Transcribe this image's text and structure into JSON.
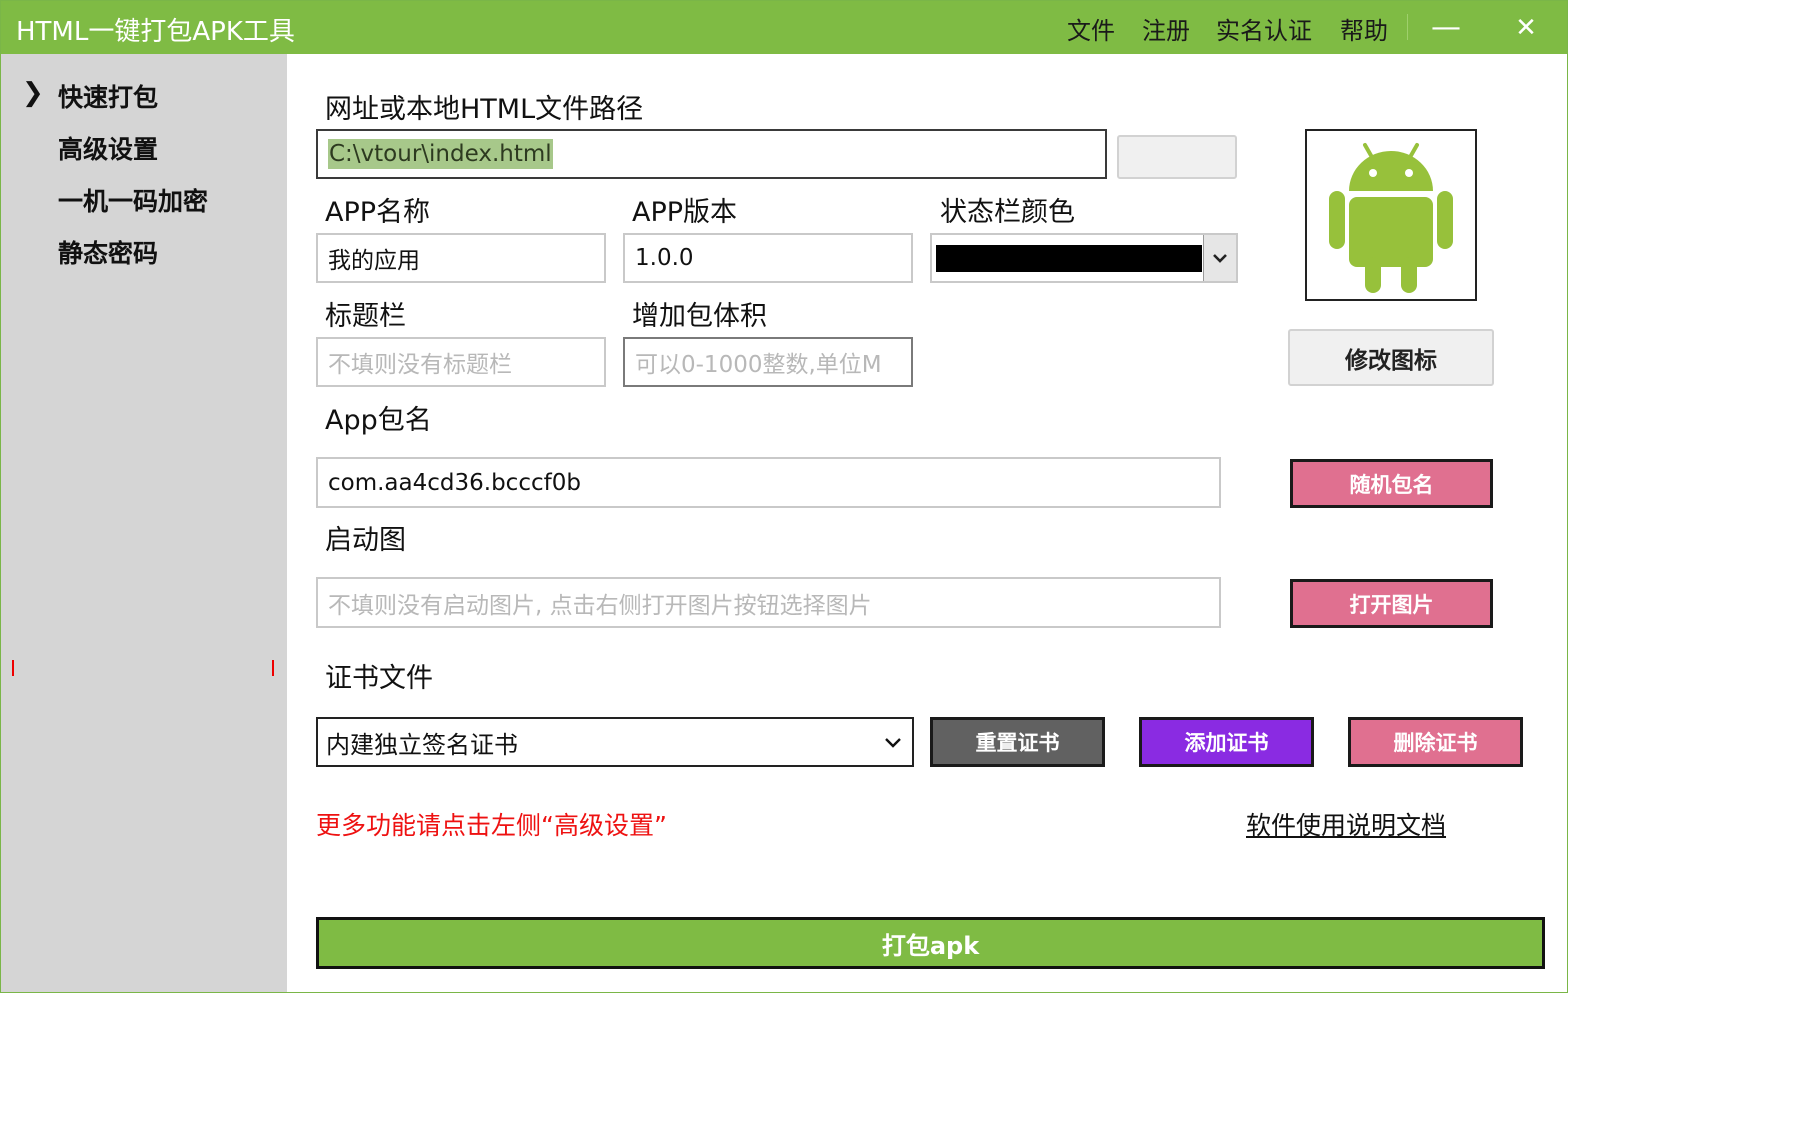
{
  "window": {
    "title": "HTML一键打包APK工具",
    "menu": [
      "文件",
      "注册",
      "实名认证",
      "帮助"
    ],
    "minimize_glyph": "—",
    "close_glyph": "✕"
  },
  "sidebar": {
    "active_marker": "❯",
    "items": [
      {
        "label": "快速打包"
      },
      {
        "label": "高级设置"
      },
      {
        "label": "一机一码加密"
      },
      {
        "label": "静态密码"
      }
    ]
  },
  "form": {
    "path_label": "网址或本地HTML文件路径",
    "path_value": "C:\\vtour\\index.html",
    "browse_label": "...",
    "app_name_label": "APP名称",
    "app_name_value": "我的应用",
    "app_version_label": "APP版本",
    "app_version_value": "1.0.0",
    "statusbar_color_label": "状态栏颜色",
    "statusbar_color_value": "#000000",
    "titlebar_label": "标题栏",
    "titlebar_placeholder": "不填则没有标题栏",
    "size_label": "增加包体积",
    "size_placeholder": "可以0-1000整数,单位M",
    "package_label": "App包名",
    "package_value": "com.aa4cd36.bcccf0b",
    "splash_label": "启动图",
    "splash_placeholder": "不填则没有启动图片, 点击右侧打开图片按钮选择图片",
    "cert_label": "证书文件",
    "cert_selected": "内建独立签名证书"
  },
  "buttons": {
    "change_icon": "修改图标",
    "random_package": "随机包名",
    "open_image": "打开图片",
    "reset_cert": "重置证书",
    "add_cert": "添加证书",
    "delete_cert": "删除证书",
    "build": "打包apk"
  },
  "colors": {
    "titlebar": "#7fbb44",
    "pink_button": "#e07090",
    "purple_button": "#8a2be2",
    "gray_button": "#616161",
    "android_green": "#97c13b"
  },
  "icons": {
    "app_icon": "android-robot-icon",
    "dropdown": "chevron-down-icon"
  },
  "footer": {
    "hint": "更多功能请点击左侧“高级设置”",
    "doc_link": "软件使用说明文档"
  }
}
